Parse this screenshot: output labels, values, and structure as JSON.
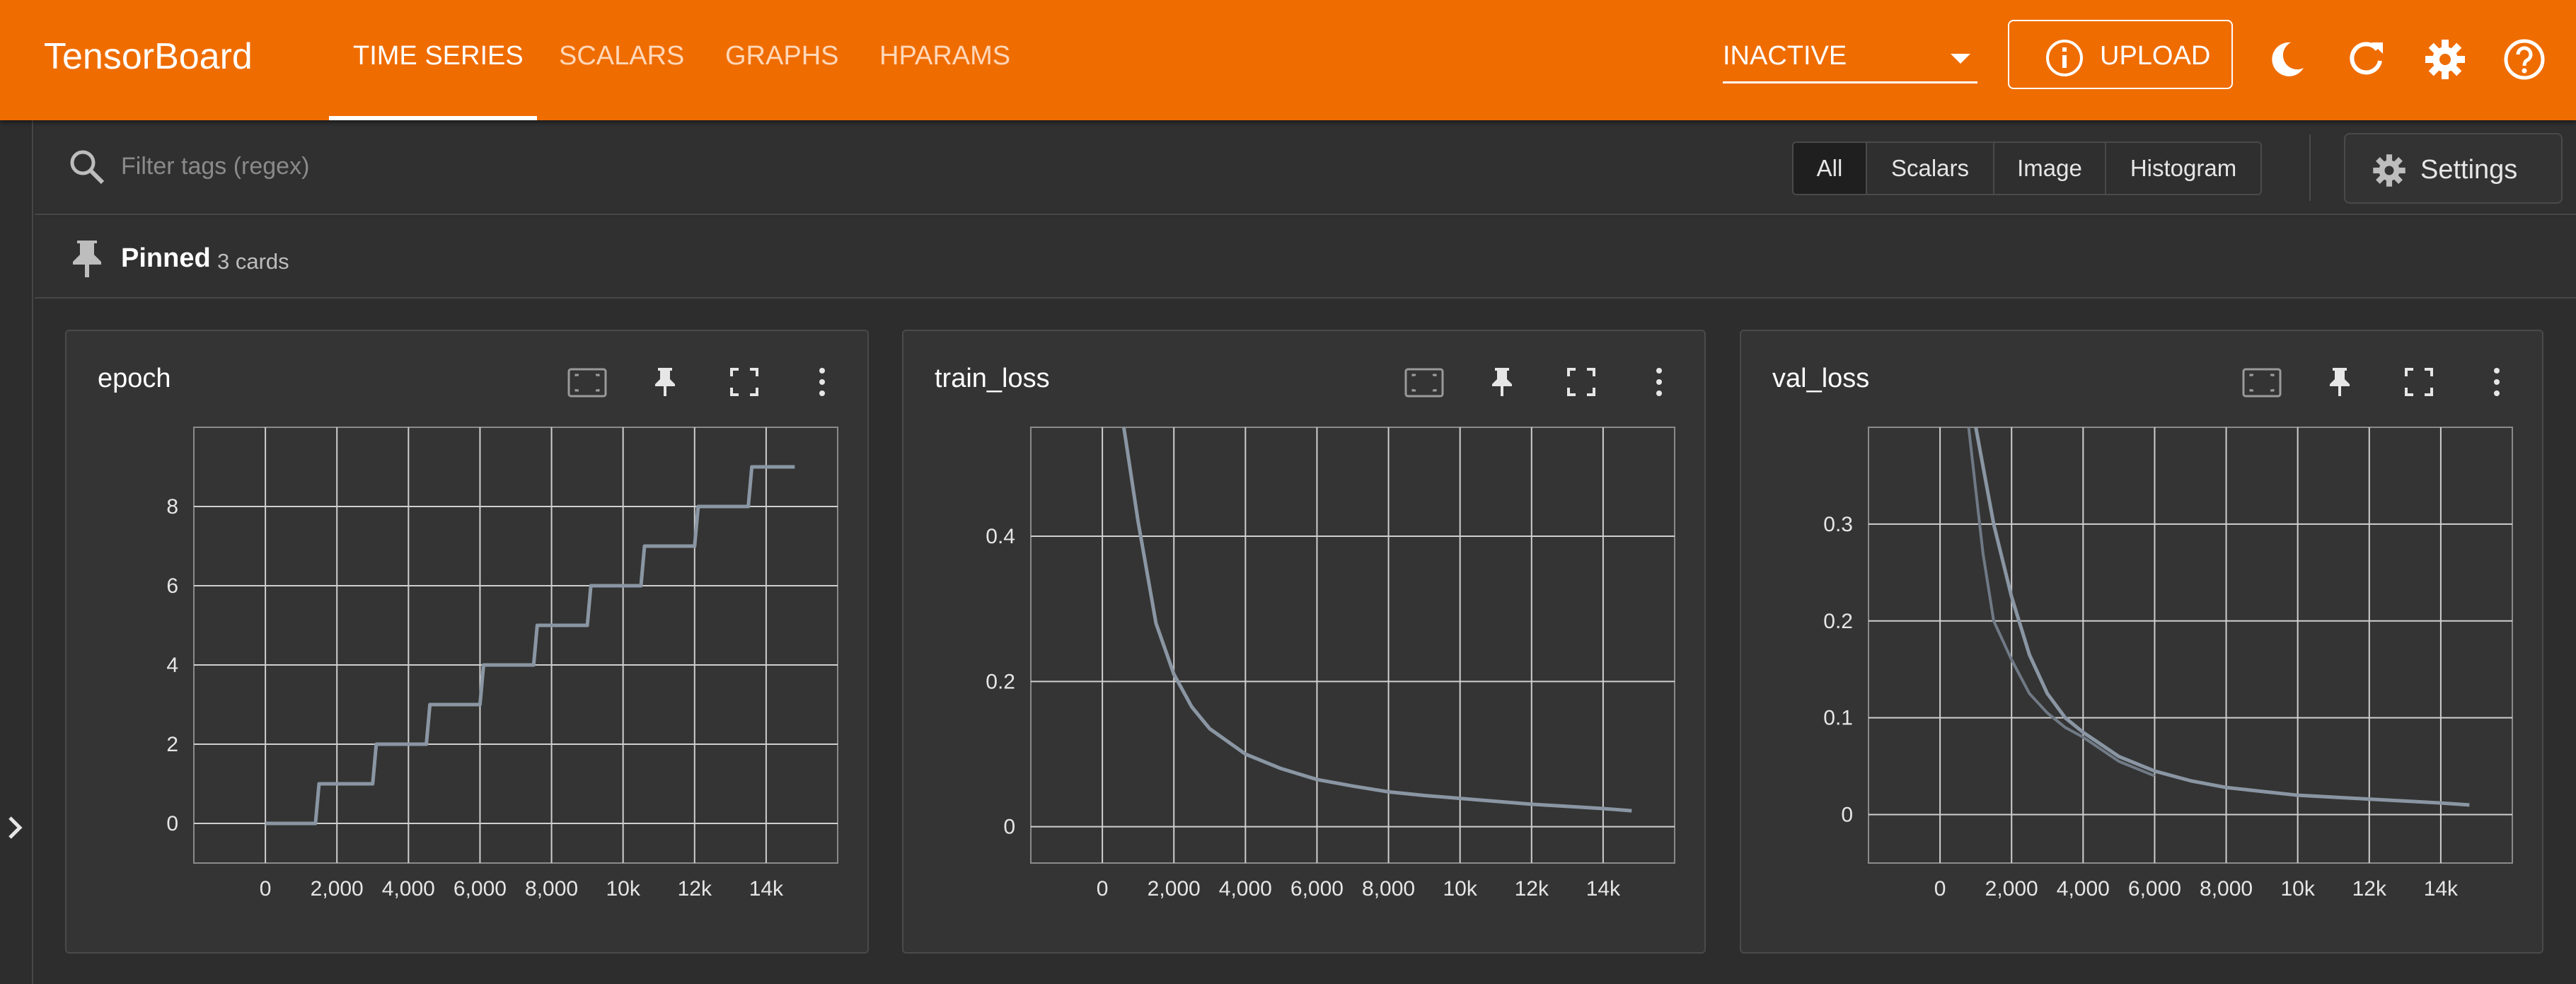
{
  "app": {
    "title": "TensorBoard"
  },
  "nav": {
    "tabs": [
      {
        "label": "TIME SERIES",
        "active": true
      },
      {
        "label": "SCALARS",
        "active": false
      },
      {
        "label": "GRAPHS",
        "active": false
      },
      {
        "label": "HPARAMS",
        "active": false
      }
    ]
  },
  "toolbar": {
    "run_state": "INACTIVE",
    "upload_label": "UPLOAD",
    "icons": [
      "dark-mode-icon",
      "reload-icon",
      "settings-icon",
      "help-icon"
    ]
  },
  "filter": {
    "placeholder": "Filter tags (regex)",
    "types": [
      {
        "label": "All",
        "selected": true
      },
      {
        "label": "Scalars",
        "selected": false
      },
      {
        "label": "Image",
        "selected": false
      },
      {
        "label": "Histogram",
        "selected": false
      }
    ],
    "settings_label": "Settings"
  },
  "pinned": {
    "title": "Pinned",
    "count": "3 cards"
  },
  "colors": {
    "accent": "#ef6c00",
    "line": "#8a96a3",
    "line_dark": "#707a86",
    "grid": "#cfcfcf"
  },
  "chart_data": [
    {
      "type": "line",
      "title": "epoch",
      "x_ticks": [
        "0",
        "2,000",
        "4,000",
        "6,000",
        "8,000",
        "10k",
        "12k",
        "14k"
      ],
      "x_tick_values": [
        0,
        2000,
        4000,
        6000,
        8000,
        10000,
        12000,
        14000
      ],
      "xlim": [
        -2000,
        16000
      ],
      "y_ticks": [
        "0",
        "2",
        "4",
        "6",
        "8"
      ],
      "y_tick_values": [
        0,
        2,
        4,
        6,
        8
      ],
      "ylim": [
        -1,
        10
      ],
      "series": [
        {
          "x": [
            0,
            1400,
            1500,
            3000,
            3100,
            4500,
            4600,
            6000,
            6100,
            7500,
            7600,
            9000,
            9100,
            10500,
            10600,
            12000,
            12100,
            13500,
            13600,
            14800
          ],
          "y": [
            0,
            0,
            1,
            1,
            2,
            2,
            3,
            3,
            4,
            4,
            5,
            5,
            6,
            6,
            7,
            7,
            8,
            8,
            9,
            9
          ]
        }
      ]
    },
    {
      "type": "line",
      "title": "train_loss",
      "x_ticks": [
        "0",
        "2,000",
        "4,000",
        "6,000",
        "8,000",
        "10k",
        "12k",
        "14k"
      ],
      "x_tick_values": [
        0,
        2000,
        4000,
        6000,
        8000,
        10000,
        12000,
        14000
      ],
      "xlim": [
        -2000,
        16000
      ],
      "y_ticks": [
        "0",
        "0.2",
        "0.4"
      ],
      "y_tick_values": [
        0,
        0.2,
        0.4
      ],
      "ylim": [
        -0.05,
        0.55
      ],
      "series": [
        {
          "x": [
            600,
            1000,
            1500,
            2000,
            2500,
            3000,
            4000,
            5000,
            6000,
            7000,
            8000,
            9000,
            10000,
            11000,
            12000,
            13000,
            14000,
            14800
          ],
          "y": [
            0.55,
            0.42,
            0.28,
            0.21,
            0.165,
            0.135,
            0.1,
            0.08,
            0.065,
            0.056,
            0.048,
            0.043,
            0.039,
            0.035,
            0.031,
            0.028,
            0.025,
            0.022
          ]
        }
      ]
    },
    {
      "type": "line",
      "title": "val_loss",
      "x_ticks": [
        "0",
        "2,000",
        "4,000",
        "6,000",
        "8,000",
        "10k",
        "12k",
        "14k"
      ],
      "x_tick_values": [
        0,
        2000,
        4000,
        6000,
        8000,
        10000,
        12000,
        14000
      ],
      "xlim": [
        -2000,
        16000
      ],
      "y_ticks": [
        "0",
        "0.1",
        "0.2",
        "0.3"
      ],
      "y_tick_values": [
        0,
        0.1,
        0.2,
        0.3
      ],
      "ylim": [
        -0.05,
        0.4
      ],
      "series": [
        {
          "x": [
            1000,
            1500,
            2000,
            2500,
            3000,
            3500,
            4000,
            5000,
            6000,
            7000,
            8000,
            9000,
            10000,
            11000,
            12000,
            13000,
            14000,
            14800
          ],
          "y": [
            0.4,
            0.3,
            0.225,
            0.165,
            0.125,
            0.1,
            0.085,
            0.06,
            0.045,
            0.035,
            0.028,
            0.024,
            0.02,
            0.018,
            0.016,
            0.014,
            0.012,
            0.01
          ]
        },
        {
          "x": [
            800,
            1200,
            1500,
            2000,
            2500,
            3000,
            3500,
            4000,
            5000,
            6000
          ],
          "y": [
            0.4,
            0.27,
            0.2,
            0.16,
            0.125,
            0.105,
            0.09,
            0.08,
            0.055,
            0.04
          ]
        }
      ]
    }
  ]
}
